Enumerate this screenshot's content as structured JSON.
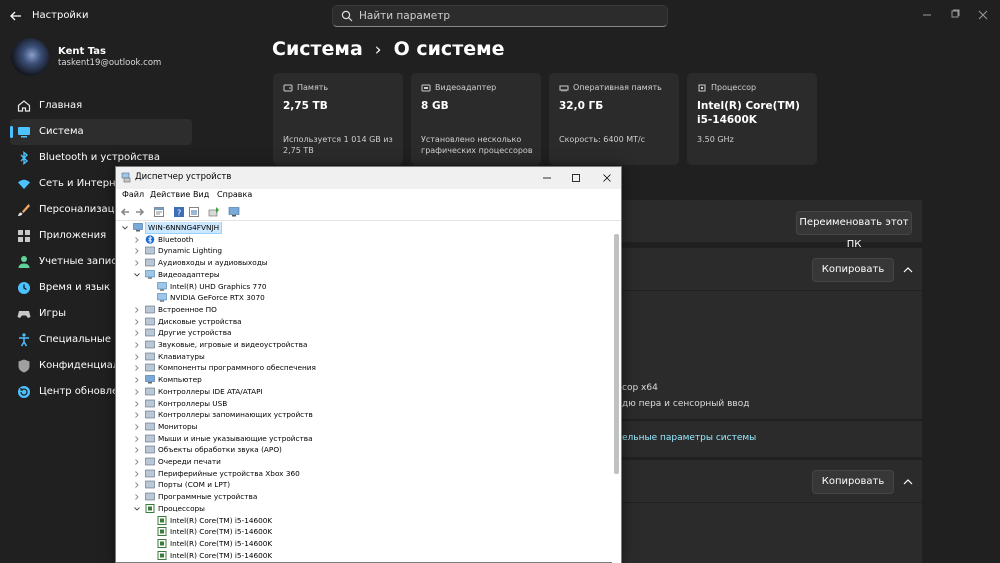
{
  "settings": {
    "window_title": "Настройки",
    "search_placeholder": "Найти параметр",
    "user": {
      "name": "Kent Tas",
      "email": "taskent19@outlook.com"
    },
    "nav": [
      {
        "label": "Главная",
        "icon": "home-icon",
        "color": "#e8e8e8"
      },
      {
        "label": "Система",
        "icon": "system-icon",
        "color": "#4cc2ff",
        "active": true
      },
      {
        "label": "Bluetooth и устройства",
        "icon": "bluetooth-icon",
        "color": "#4cc2ff"
      },
      {
        "label": "Сеть и Интернет",
        "icon": "network-icon",
        "color": "#4cc2ff"
      },
      {
        "label": "Персонализация",
        "icon": "brush-icon",
        "color": "#f0a860"
      },
      {
        "label": "Приложения",
        "icon": "apps-icon",
        "color": "#c8c8c8"
      },
      {
        "label": "Учетные записи",
        "icon": "person-icon",
        "color": "#5ed39a"
      },
      {
        "label": "Время и язык",
        "icon": "globe-clock-icon",
        "color": "#4cc2ff"
      },
      {
        "label": "Игры",
        "icon": "gamepad-icon",
        "color": "#c8c8c8"
      },
      {
        "label": "Специальные возм",
        "icon": "accessibility-icon",
        "color": "#4cc2ff"
      },
      {
        "label": "Конфиденциальность",
        "icon": "shield-icon",
        "color": "#a0a0a0"
      },
      {
        "label": "Центр обновления",
        "icon": "update-icon",
        "color": "#4cc2ff"
      }
    ],
    "breadcrumb": {
      "parent": "Система",
      "separator": "›",
      "current": "О системе"
    },
    "cards": [
      {
        "label": "Память",
        "value": "2,75 TB",
        "desc": "Используется 1 014 GB из 2,75 TB",
        "icon": "storage-icon"
      },
      {
        "label": "Видеоадаптер",
        "value": "8 GB",
        "desc": "Установлено несколько графических процессоров",
        "icon": "gpu-icon"
      },
      {
        "label": "Оперативная память",
        "value": "32,0 ГБ",
        "desc": "Скорость: 6400 МТ/с",
        "icon": "ram-icon"
      },
      {
        "label": "Процессор",
        "value": "Intel(R) Core(TM) i5-14600K",
        "desc": "3.50 GHz",
        "icon": "cpu-icon"
      }
    ],
    "rename_button": "Переименовать этот ПК",
    "copy_button_1": "Копировать",
    "copy_button_2": "Копировать",
    "partial_text_1": "сор x64",
    "partial_text_2": "дю пера и сенсорный ввод",
    "partial_link": "ельные параметры системы"
  },
  "device_manager": {
    "title": "Диспетчер устройств",
    "menu": [
      "Файл",
      "Действие",
      "Вид",
      "Справка"
    ],
    "tree": [
      {
        "level": 0,
        "label": "WIN-6NNNG4FVNJH",
        "expanded": true,
        "icon": "computer-icon",
        "selected": true
      },
      {
        "level": 1,
        "label": "Bluetooth",
        "expanded": false,
        "icon": "bluetooth-icon"
      },
      {
        "level": 1,
        "label": "Dynamic Lighting",
        "expanded": false,
        "icon": "lighting-icon"
      },
      {
        "level": 1,
        "label": "Аудиовходы и аудиовыходы",
        "expanded": false,
        "icon": "audio-icon"
      },
      {
        "level": 1,
        "label": "Видеоадаптеры",
        "expanded": true,
        "icon": "display-adapter-icon"
      },
      {
        "level": 2,
        "label": "Intel(R) UHD Graphics 770",
        "icon": "display-adapter-icon"
      },
      {
        "level": 2,
        "label": "NVIDIA GeForce RTX 3070",
        "icon": "display-adapter-icon"
      },
      {
        "level": 1,
        "label": "Встроенное ПО",
        "expanded": false,
        "icon": "firmware-icon"
      },
      {
        "level": 1,
        "label": "Дисковые устройства",
        "expanded": false,
        "icon": "disk-icon"
      },
      {
        "level": 1,
        "label": "Другие устройства",
        "expanded": false,
        "icon": "unknown-device-icon"
      },
      {
        "level": 1,
        "label": "Звуковые, игровые и видеоустройства",
        "expanded": false,
        "icon": "sound-icon"
      },
      {
        "level": 1,
        "label": "Клавиатуры",
        "expanded": false,
        "icon": "keyboard-icon"
      },
      {
        "level": 1,
        "label": "Компоненты программного обеспечения",
        "expanded": false,
        "icon": "software-component-icon"
      },
      {
        "level": 1,
        "label": "Компьютер",
        "expanded": false,
        "icon": "computer-icon"
      },
      {
        "level": 1,
        "label": "Контроллеры IDE ATA/ATAPI",
        "expanded": false,
        "icon": "ide-controller-icon"
      },
      {
        "level": 1,
        "label": "Контроллеры USB",
        "expanded": false,
        "icon": "usb-icon"
      },
      {
        "level": 1,
        "label": "Контроллеры запоминающих устройств",
        "expanded": false,
        "icon": "storage-controller-icon"
      },
      {
        "level": 1,
        "label": "Мониторы",
        "expanded": false,
        "icon": "monitor-icon"
      },
      {
        "level": 1,
        "label": "Мыши и иные указывающие устройства",
        "expanded": false,
        "icon": "mouse-icon"
      },
      {
        "level": 1,
        "label": "Объекты обработки звука (APO)",
        "expanded": false,
        "icon": "apo-icon"
      },
      {
        "level": 1,
        "label": "Очереди печати",
        "expanded": false,
        "icon": "printer-icon"
      },
      {
        "level": 1,
        "label": "Периферийные устройства Xbox 360",
        "expanded": false,
        "icon": "gamepad-icon"
      },
      {
        "level": 1,
        "label": "Порты (COM и LPT)",
        "expanded": false,
        "icon": "port-icon"
      },
      {
        "level": 1,
        "label": "Программные устройства",
        "expanded": false,
        "icon": "software-device-icon"
      },
      {
        "level": 1,
        "label": "Процессоры",
        "expanded": true,
        "icon": "processor-icon"
      },
      {
        "level": 2,
        "label": "Intel(R) Core(TM) i5-14600K",
        "icon": "processor-icon"
      },
      {
        "level": 2,
        "label": "Intel(R) Core(TM) i5-14600K",
        "icon": "processor-icon"
      },
      {
        "level": 2,
        "label": "Intel(R) Core(TM) i5-14600K",
        "icon": "processor-icon"
      },
      {
        "level": 2,
        "label": "Intel(R) Core(TM) i5-14600K",
        "icon": "processor-icon"
      }
    ]
  }
}
